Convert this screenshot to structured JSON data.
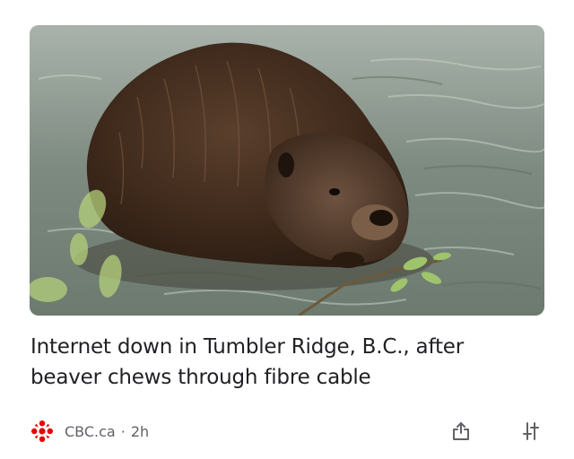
{
  "article": {
    "image_alt": "Beaver in water chewing a branch",
    "headline": "Internet down in Tumbler Ridge, B.C., after beaver chews through fibre cable"
  },
  "source": {
    "name": "CBC.ca",
    "separator": "·",
    "time": "2h",
    "logo_icon": "cbc-gem-icon",
    "logo_color": "#e60505"
  },
  "actions": {
    "share_icon": "share-icon",
    "more_icon": "sort-options-icon"
  },
  "colors": {
    "headline_text": "#202124",
    "meta_text": "#5f6368",
    "icon": "#5f6368"
  }
}
